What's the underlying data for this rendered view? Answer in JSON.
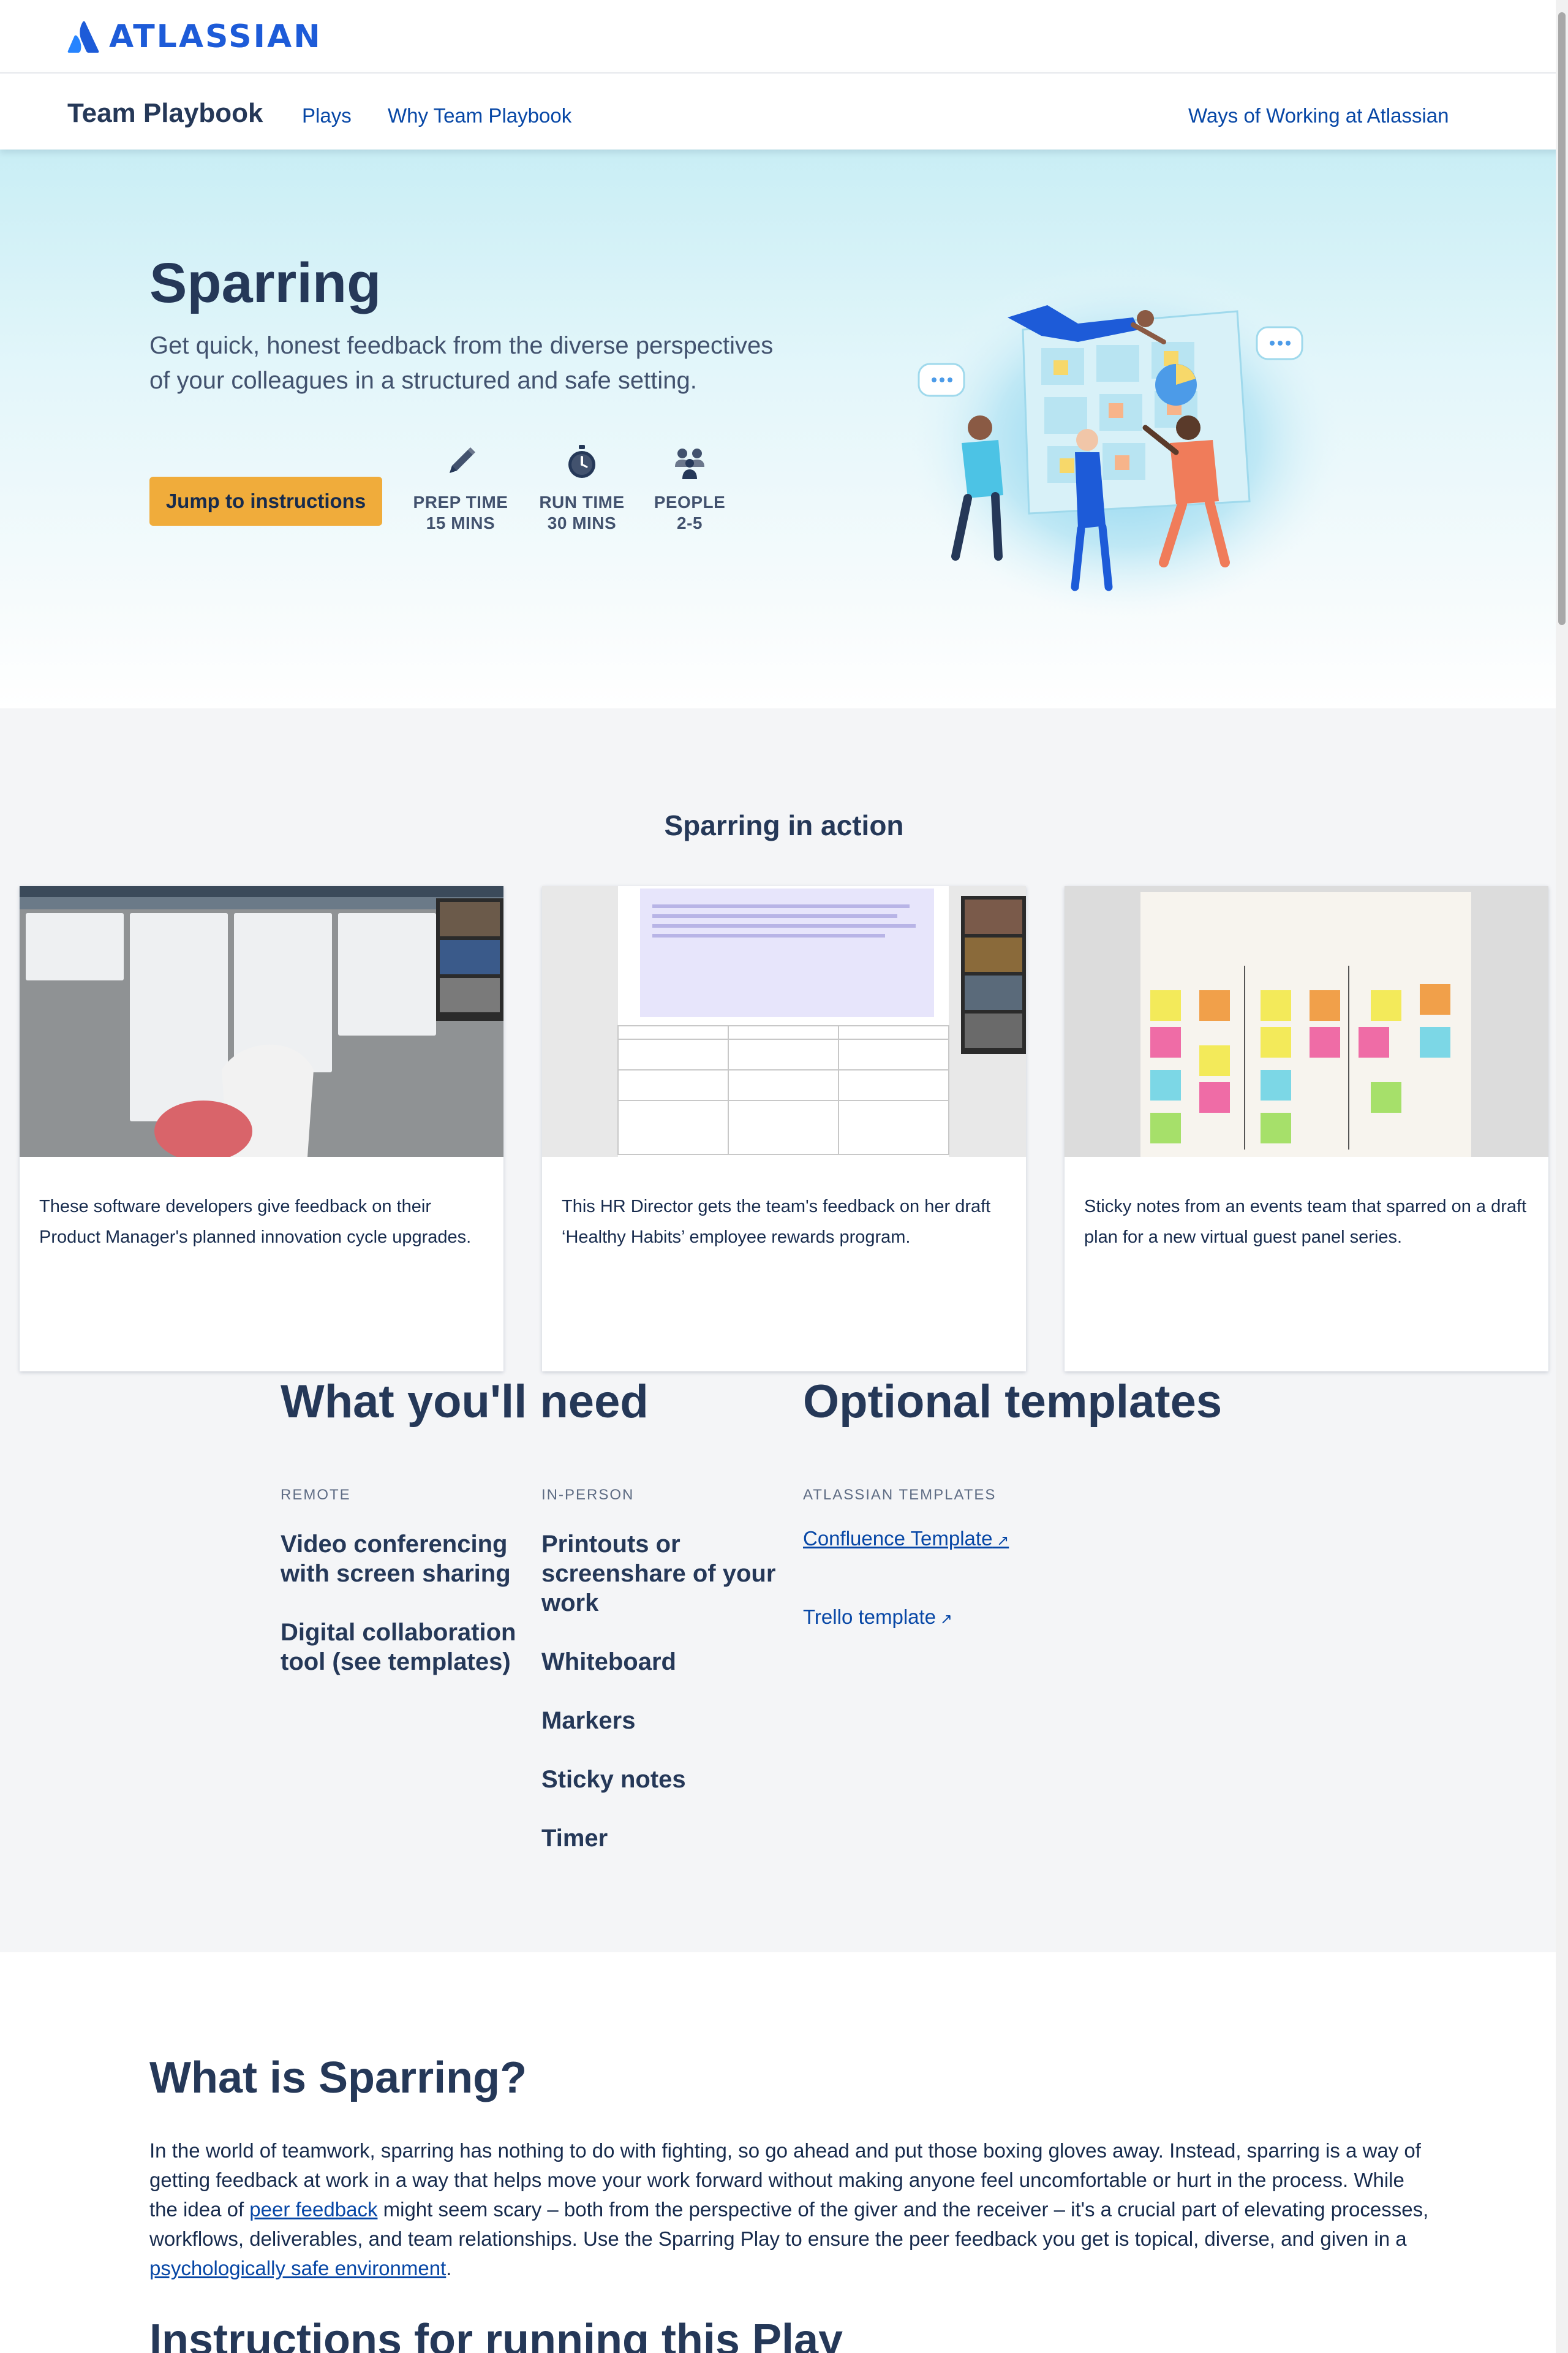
{
  "brand": {
    "logo_text": "ATLASSIAN"
  },
  "nav": {
    "title": "Team Playbook",
    "links": [
      "Plays",
      "Why Team Playbook"
    ],
    "right_link": "Ways of Working at Atlassian"
  },
  "hero": {
    "title": "Sparring",
    "description": "Get quick, honest feedback from the diverse perspectives of your colleagues in a structured and safe setting.",
    "button": "Jump to instructions",
    "stats": [
      {
        "icon": "pencil-icon",
        "line1": "PREP TIME",
        "line2": "15 MINS"
      },
      {
        "icon": "stopwatch-icon",
        "line1": "RUN TIME",
        "line2": "30 MINS"
      },
      {
        "icon": "people-icon",
        "line1": "PEOPLE",
        "line2": "2-5"
      }
    ]
  },
  "in_action": {
    "title": "Sparring in action",
    "cards": [
      {
        "caption": "These software developers give feedback on their Product Manager's planned innovation cycle upgrades."
      },
      {
        "caption": "This HR Director gets the team's feedback on her draft ‘Healthy Habits’ employee rewards program."
      },
      {
        "caption": "Sticky notes from an events team that sparred on a draft plan for a new virtual guest panel series."
      }
    ]
  },
  "needs": {
    "title": "What you'll need",
    "remote_head": "REMOTE",
    "remote_items": [
      "Video conferencing with screen sharing",
      "Digital collaboration tool (see templates)"
    ],
    "inperson_head": "IN-PERSON",
    "inperson_items": [
      "Printouts or screenshare of your work",
      "Whiteboard",
      "Markers",
      "Sticky notes",
      "Timer"
    ]
  },
  "templates": {
    "title": "Optional templates",
    "head": "ATLASSIAN TEMPLATES",
    "confluence": "Confluence Template",
    "trello": "Trello template"
  },
  "what_is": {
    "title": "What is Sparring?",
    "p1": "In the world of teamwork, sparring has nothing to do with fighting, so go ahead and put those boxing gloves away. Instead, sparring is a way of getting feedback at work in a way that helps move your work forward without making anyone feel uncomfortable or hurt in the process. While the idea of ",
    "link1": "peer feedback",
    "p2": " might seem scary – both from the perspective of the giver and the receiver – it's a crucial part of elevating processes, workflows, deliverables, and team relationships. Use the Sparring Play to ensure the peer feedback you get is topical, diverse, and given in a ",
    "link2": "psychologically safe environment",
    "p3": "."
  },
  "instructions": {
    "title": "Instructions for running this Play"
  },
  "colors": {
    "brand_blue": "#1d5bd8",
    "link": "#0747a6",
    "button": "#f0ac3b",
    "heading": "#253858"
  }
}
